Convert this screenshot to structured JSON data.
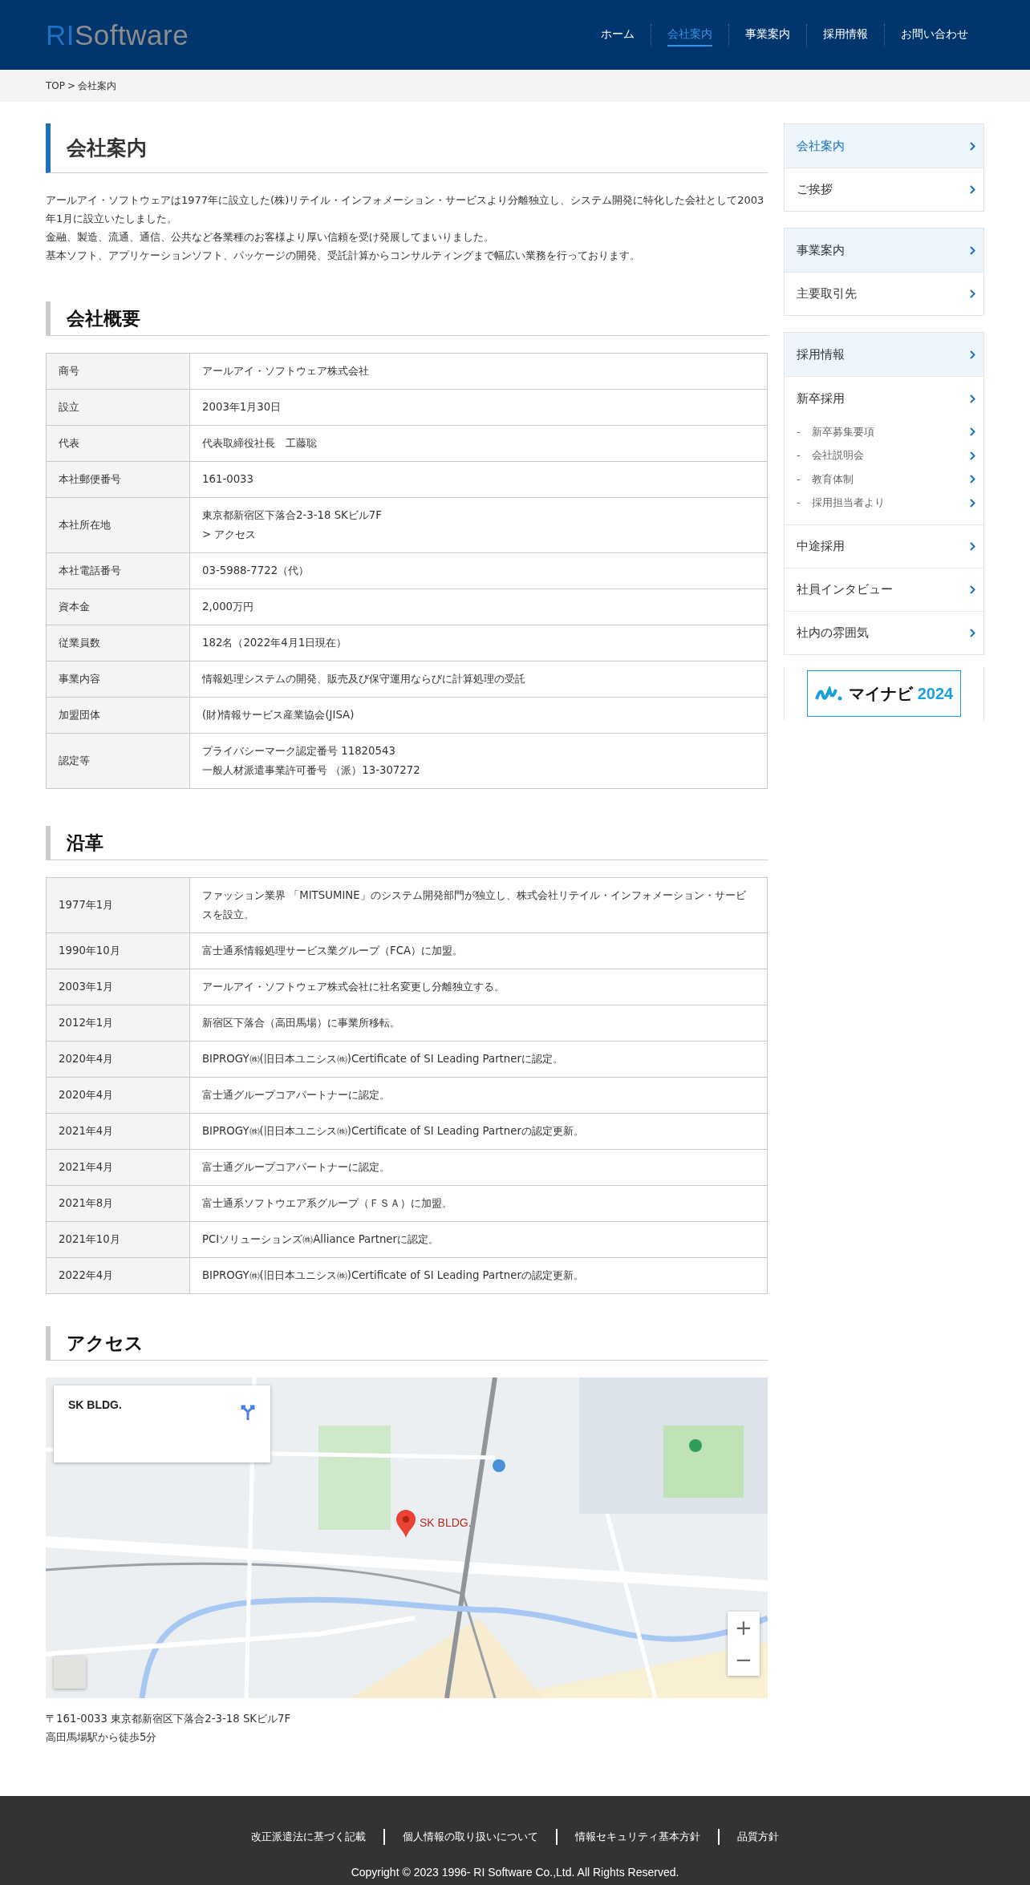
{
  "header": {
    "logo": {
      "accent": "RI",
      "rest": "Software"
    },
    "nav": [
      {
        "label": "ホーム",
        "selected": false
      },
      {
        "label": "会社案内",
        "selected": true
      },
      {
        "label": "事業案内",
        "selected": false
      },
      {
        "label": "採用情報",
        "selected": false
      },
      {
        "label": "お問い合わせ",
        "selected": false
      }
    ]
  },
  "breadcrumb": {
    "items": [
      "TOP",
      "会社案内"
    ],
    "separator": ">"
  },
  "page_title": "会社案内",
  "intro": [
    "アールアイ・ソフトウェアは1977年に設立した(株)リテイル・インフォメーション・サービスより分離独立し、システム開発に特化した会社として2003年1月に設立いたしました。",
    "金融、製造、流通、通信、公共など各業種のお客様より厚い信頼を受け発展してまいりました。",
    "基本ソフト、アプリケーションソフト、パッケージの開発、受託計算からコンサルティングまで幅広い業務を行っております。"
  ],
  "overview": {
    "heading": "会社概要",
    "rows": [
      {
        "label": "商号",
        "lines": [
          "アールアイ・ソフトウェア株式会社"
        ]
      },
      {
        "label": "設立",
        "lines": [
          "2003年1月30日"
        ]
      },
      {
        "label": "代表",
        "lines": [
          "代表取締役社長　工藤聡"
        ]
      },
      {
        "label": "本社郵便番号",
        "lines": [
          "161-0033"
        ]
      },
      {
        "label": "本社所在地",
        "lines": [
          "東京都新宿区下落合2-3-18 SKビル7F",
          "> アクセス"
        ]
      },
      {
        "label": "本社電話番号",
        "lines": [
          "03-5988-7722（代）"
        ]
      },
      {
        "label": "資本金",
        "lines": [
          "2,000万円"
        ]
      },
      {
        "label": "従業員数",
        "lines": [
          "182名（2022年4月1日現在）"
        ]
      },
      {
        "label": "事業内容",
        "lines": [
          "情報処理システムの開発、販売及び保守運用ならびに計算処理の受託"
        ]
      },
      {
        "label": "加盟団体",
        "lines": [
          "(財)情報サービス産業協会(JISA)"
        ]
      },
      {
        "label": "認定等",
        "lines": [
          "プライバシーマーク認定番号 11820543",
          "一般人材派遣事業許可番号 （派）13-307272"
        ]
      }
    ]
  },
  "history": {
    "heading": "沿革",
    "rows": [
      {
        "label": "1977年1月",
        "lines": [
          "ファッション業界 「MITSUMINE」のシステム開発部門が独立し、株式会社リテイル・インフォメーション・サービスを設立。"
        ]
      },
      {
        "label": "1990年10月",
        "lines": [
          "富士通系情報処理サービス業グループ（FCA）に加盟。"
        ]
      },
      {
        "label": "2003年1月",
        "lines": [
          "アールアイ・ソフトウェア株式会社に社名変更し分離独立する。"
        ]
      },
      {
        "label": "2012年1月",
        "lines": [
          "新宿区下落合（高田馬場）に事業所移転。"
        ]
      },
      {
        "label": "2020年4月",
        "lines": [
          "BIPROGY㈱(旧日本ユニシス㈱)Certificate of SI Leading Partnerに認定。"
        ]
      },
      {
        "label": "2020年4月",
        "lines": [
          "富士通グループコアパートナーに認定。"
        ]
      },
      {
        "label": "2021年4月",
        "lines": [
          "BIPROGY㈱(旧日本ユニシス㈱)Certificate of SI Leading Partnerの認定更新。"
        ]
      },
      {
        "label": "2021年4月",
        "lines": [
          "富士通グループコアパートナーに認定。"
        ]
      },
      {
        "label": "2021年8月",
        "lines": [
          "富士通系ソフトウエア系グループ（ＦＳＡ）に加盟。"
        ]
      },
      {
        "label": "2021年10月",
        "lines": [
          "PCIソリューションズ㈱Alliance Partnerに認定。"
        ]
      },
      {
        "label": "2022年4月",
        "lines": [
          "BIPROGY㈱(旧日本ユニシス㈱)Certificate of SI Leading Partnerの認定更新。"
        ]
      }
    ]
  },
  "access": {
    "heading": "アクセス",
    "map": {
      "kind": "picture",
      "place_card": {
        "title": "SK BLDG."
      },
      "marker_label": "SK BLDG.",
      "zoom_in": "+",
      "zoom_out": "−"
    },
    "address": [
      "〒161-0033 東京都新宿区下落合2-3-18 SKビル7F",
      "高田馬場駅から徒歩5分"
    ]
  },
  "sidebar": {
    "groups": [
      {
        "items": [
          {
            "kind": "heading",
            "label": "会社案内",
            "selected": true
          },
          {
            "kind": "item",
            "label": "ご挨拶",
            "selected": false
          }
        ]
      },
      {
        "items": [
          {
            "kind": "heading",
            "label": "事業案内",
            "selected": false
          },
          {
            "kind": "item",
            "label": "主要取引先",
            "selected": false
          }
        ]
      },
      {
        "items": [
          {
            "kind": "heading",
            "label": "採用情報",
            "selected": false
          },
          {
            "kind": "item",
            "label": "新卒採用",
            "selected": false,
            "children": [
              {
                "bullet": "-",
                "label": "新卒募集要項",
                "selected": false
              },
              {
                "bullet": "-",
                "label": "会社説明会",
                "selected": false
              },
              {
                "bullet": "-",
                "label": "教育体制",
                "selected": false
              },
              {
                "bullet": "-",
                "label": "採用担当者より",
                "selected": false
              }
            ]
          },
          {
            "kind": "item",
            "label": "中途採用",
            "selected": false
          },
          {
            "kind": "item",
            "label": "社員インタビュー",
            "selected": false
          },
          {
            "kind": "item",
            "label": "社内の雰囲気",
            "selected": false
          }
        ]
      }
    ],
    "banner": {
      "name": "マイナビ",
      "year": "2024"
    }
  },
  "footer": {
    "links": [
      "改正派遣法に基づく記載",
      "個人情報の取り扱いについて",
      "情報セキュリティ基本方針",
      "品質方針"
    ],
    "copyright": "Copyright © 2023 1996- RI Software Co.,Ltd. All Rights Reserved."
  }
}
